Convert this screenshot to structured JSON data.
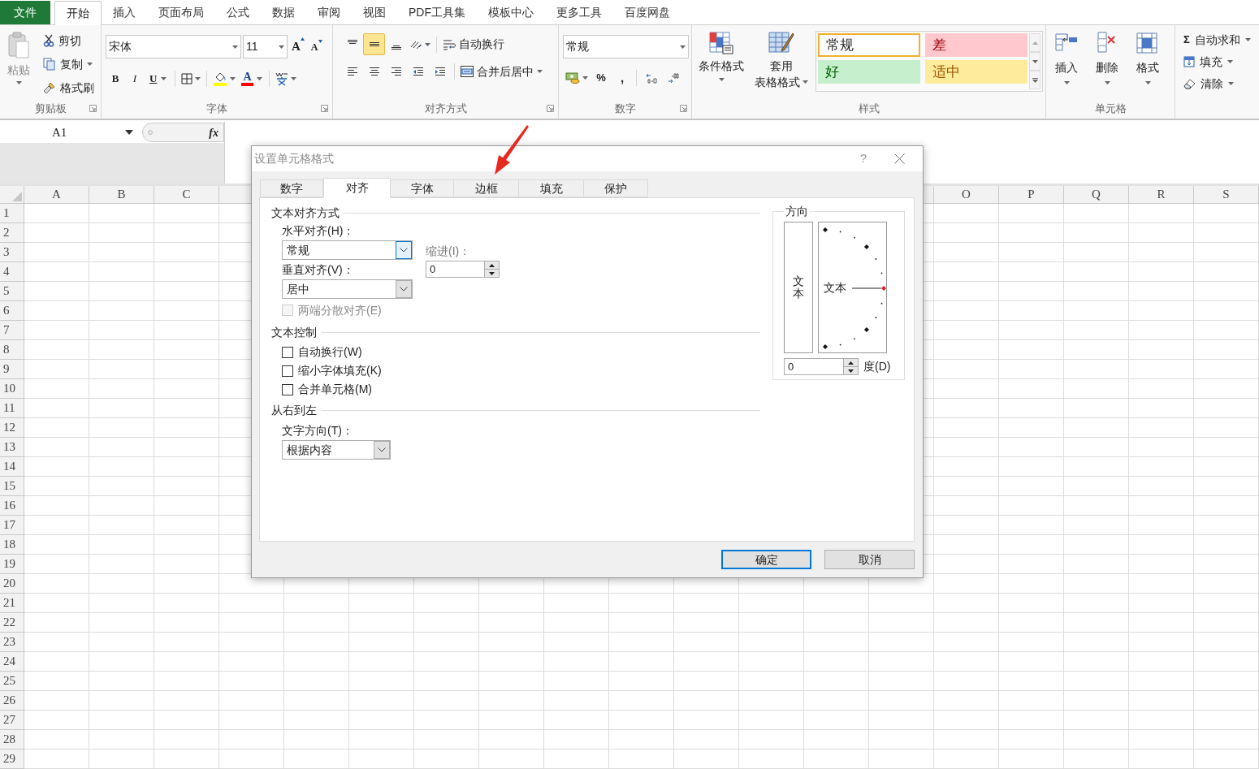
{
  "menu_tabs": [
    {
      "label": "文件",
      "kind": "file",
      "selected": false
    },
    {
      "label": "开始",
      "kind": "tab",
      "selected": true
    },
    {
      "label": "插入",
      "kind": "tab",
      "selected": false
    },
    {
      "label": "页面布局",
      "kind": "tab",
      "selected": false
    },
    {
      "label": "公式",
      "kind": "tab",
      "selected": false
    },
    {
      "label": "数据",
      "kind": "tab",
      "selected": false
    },
    {
      "label": "审阅",
      "kind": "tab",
      "selected": false
    },
    {
      "label": "视图",
      "kind": "tab",
      "selected": false
    },
    {
      "label": "PDF工具集",
      "kind": "tab",
      "selected": false
    },
    {
      "label": "模板中心",
      "kind": "tab",
      "selected": false
    },
    {
      "label": "更多工具",
      "kind": "tab",
      "selected": false
    },
    {
      "label": "百度网盘",
      "kind": "tab",
      "selected": false
    }
  ],
  "ribbon": {
    "clipboard": {
      "label": "剪贴板",
      "paste": "粘贴",
      "cut": "剪切",
      "copy": "复制",
      "format_painter": "格式刷"
    },
    "font": {
      "label": "字体",
      "font_name": "宋体",
      "font_size": "11",
      "grow": "A",
      "shrink": "A",
      "bold": "B",
      "italic": "I",
      "underline": "U",
      "font_color": "A"
    },
    "alignment": {
      "label": "对齐方式",
      "vertical_align": [
        {
          "selected": false
        },
        {
          "selected": true
        },
        {
          "selected": false
        }
      ],
      "wrap_text": "自动换行",
      "merge_center": "合并后居中"
    },
    "number": {
      "label": "数字",
      "format": "常规",
      "percent": "%",
      "comma": ","
    },
    "styles": {
      "label": "样式",
      "conditional": "条件格式",
      "table_format": [
        "套用",
        "表格格式"
      ],
      "gallery": [
        {
          "label": "常规",
          "kind": "normal",
          "selected": true
        },
        {
          "label": "差",
          "kind": "bad",
          "selected": false
        },
        {
          "label": "好",
          "kind": "good",
          "selected": false
        },
        {
          "label": "适中",
          "kind": "neutral",
          "selected": false
        }
      ]
    },
    "cells": {
      "label": "单元格",
      "buttons": [
        {
          "label": "插入",
          "kind": "insert"
        },
        {
          "label": "删除",
          "kind": "delete"
        },
        {
          "label": "格式",
          "kind": "format"
        }
      ]
    },
    "editing": {
      "autosum_symbol": "Σ",
      "autosum": "自动求和",
      "fill": "填充",
      "clear": "清除"
    }
  },
  "formula_bar": {
    "name_box": "A1",
    "fx": "fx"
  },
  "sheet": {
    "columns_left": [
      "A",
      "B",
      "C"
    ],
    "columns_right": [
      "O",
      "P",
      "Q",
      "R",
      "S"
    ],
    "rows": [
      "1",
      "2",
      "3",
      "4",
      "5",
      "6",
      "7",
      "8",
      "9",
      "10",
      "11",
      "12",
      "13",
      "14",
      "15",
      "16",
      "17",
      "18",
      "19",
      "20",
      "21",
      "22",
      "23",
      "24",
      "25",
      "26",
      "27",
      "28",
      "29"
    ]
  },
  "dialog": {
    "title": "设置单元格格式",
    "help": "?",
    "tabs": [
      {
        "label": "数字",
        "selected": false
      },
      {
        "label": "对齐",
        "selected": true
      },
      {
        "label": "字体",
        "selected": false
      },
      {
        "label": "边框",
        "selected": false
      },
      {
        "label": "填充",
        "selected": false
      },
      {
        "label": "保护",
        "selected": false
      }
    ],
    "text_alignment": {
      "heading": "文本对齐方式",
      "horizontal_label": "水平对齐(H)：",
      "horizontal_value": "常规",
      "horizontal_focused": true,
      "indent_label": "缩进(I)：",
      "indent_value": "0",
      "vertical_label": "垂直对齐(V)：",
      "vertical_value": "居中",
      "distributed": {
        "label": "两端分散对齐(E)",
        "checked": false,
        "disabled": true
      }
    },
    "text_control": {
      "heading": "文本控制",
      "options": [
        {
          "label": "自动换行(W)",
          "checked": false
        },
        {
          "label": "缩小字体填充(K)",
          "checked": false
        },
        {
          "label": "合并单元格(M)",
          "checked": false
        }
      ]
    },
    "right_to_left": {
      "heading": "从右到左",
      "direction_label": "文字方向(T)：",
      "direction_value": "根据内容"
    },
    "orientation": {
      "heading": "方向",
      "vertical_text": "文本",
      "dial_text": "文本",
      "degrees_value": "0",
      "degrees_label": "度(D)"
    },
    "buttons": [
      {
        "label": "确定",
        "default": true
      },
      {
        "label": "取消",
        "default": false
      }
    ]
  }
}
